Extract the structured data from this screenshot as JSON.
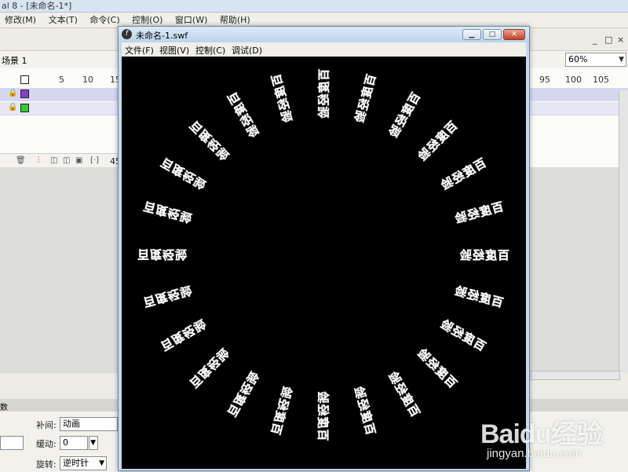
{
  "app": {
    "title": "al 8 - [未命名-1*]",
    "menu": [
      "修改(M)",
      "文本(T)",
      "命令(C)",
      "控制(O)",
      "窗口(W)",
      "帮助(H)"
    ],
    "controls": [
      "_",
      "□",
      "×"
    ]
  },
  "scene": {
    "label": "场景 1"
  },
  "zoom": {
    "value": "60%"
  },
  "timeline": {
    "ruler_left": [
      "5",
      "10",
      "15"
    ],
    "ruler_right": [
      "95",
      "100",
      "105"
    ],
    "frame_counter": "45"
  },
  "properties": {
    "header": "数",
    "tween_label": "补间:",
    "tween_value": "动画",
    "ease_label": "缓动:",
    "ease_value": "0",
    "rotate_label": "旋转:",
    "rotate_value": "逆时针"
  },
  "swf": {
    "title": "未命名-1.swf",
    "menu": [
      "文件(F)",
      "视图(V)",
      "控制(C)",
      "调试(D)"
    ],
    "ring_text": "百度经验",
    "ring_count": 24,
    "ring_text_color": "#ffffff",
    "stage_color": "#000000"
  },
  "watermark": {
    "logo": "Baidu经验",
    "url": "jingyan.baidu.com"
  }
}
